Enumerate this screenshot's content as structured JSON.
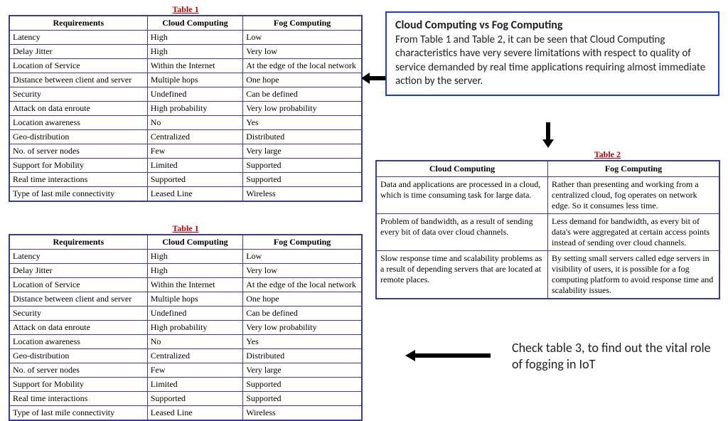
{
  "table1": {
    "caption": "Table 1",
    "headers": [
      "Requirements",
      "Cloud Computing",
      "Fog Computing"
    ],
    "rows": [
      [
        "Latency",
        "High",
        "Low"
      ],
      [
        "Delay Jitter",
        "High",
        "Very low"
      ],
      [
        "Location of Service",
        "Within the Internet",
        "At the edge of the local network"
      ],
      [
        "Distance between client and server",
        "Multiple hops",
        "One hope"
      ],
      [
        "Security",
        "Undefined",
        "Can be defined"
      ],
      [
        "Attack on data enroute",
        "High probability",
        "Very low probability"
      ],
      [
        "Location awareness",
        "No",
        "Yes"
      ],
      [
        "Geo-distribution",
        "Centralized",
        "Distributed"
      ],
      [
        "No. of server nodes",
        "Few",
        "Very large"
      ],
      [
        "Support for Mobility",
        "Limited",
        "Supported"
      ],
      [
        "Real time interactions",
        "Supported",
        "Supported"
      ],
      [
        "Type of last mile connectivity",
        "Leased Line",
        "Wireless"
      ]
    ]
  },
  "table2": {
    "caption": "Table 2",
    "headers": [
      "Cloud Computing",
      "Fog Computing"
    ],
    "rows": [
      [
        "Data and applications are processed in a cloud, which is time consuming task for large data.",
        "Rather than presenting and working from a centralized cloud, fog operates on network edge. So it consumes less time."
      ],
      [
        "Problem of bandwidth, as a result of sending every bit of data over cloud channels.",
        "Less demand for bandwidth, as every bit of data's were aggregated at certain access points instead of sending over cloud channels."
      ],
      [
        "Slow response time and scalability problems as a result of depending servers that are located at remote places.",
        "By setting small servers called edge servers in visibility of users, it is possible for a fog computing platform to avoid response time and scalability issues."
      ]
    ]
  },
  "infobox": {
    "title": "Cloud Computing vs Fog Computing",
    "body": "From Table 1 and Table 2, it can be seen that Cloud Computing characteristics have very severe limitations with respect to quality of service demanded by real time applications requiring almost immediate action by the server."
  },
  "note": "Check table 3, to find out the vital role of fogging in IoT"
}
